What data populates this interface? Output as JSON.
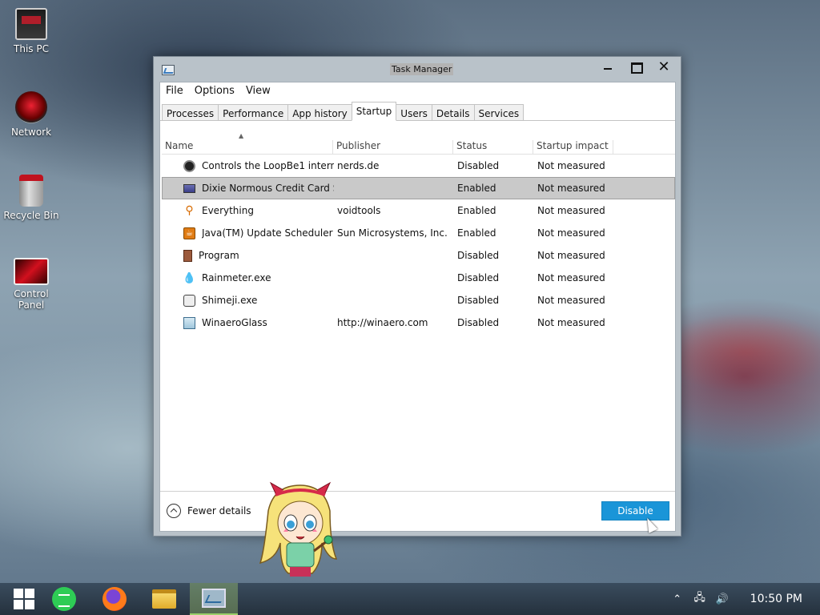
{
  "desktop": {
    "icons": [
      {
        "label": "This PC",
        "icon": "computer-icon"
      },
      {
        "label": "Network",
        "icon": "network-icon"
      },
      {
        "label": "Recycle Bin",
        "icon": "recycle-bin-icon"
      },
      {
        "label": "Control Panel",
        "icon": "control-panel-icon"
      }
    ]
  },
  "window": {
    "title": "Task Manager",
    "menu": [
      "File",
      "Options",
      "View"
    ],
    "tabs": [
      "Processes",
      "Performance",
      "App history",
      "Startup",
      "Users",
      "Details",
      "Services"
    ],
    "active_tab": "Startup",
    "columns": [
      "Name",
      "Publisher",
      "Status",
      "Startup impact"
    ],
    "rows": [
      {
        "name": "Controls the LoopBe1 intern...",
        "publisher": "nerds.de",
        "status": "Disabled",
        "impact": "Not measured",
        "icon": "loopbe-icon"
      },
      {
        "name": "Dixie Normous Credit Card S...",
        "publisher": "",
        "status": "Enabled",
        "impact": "Not measured",
        "icon": "credit-card-icon"
      },
      {
        "name": "Everything",
        "publisher": "voidtools",
        "status": "Enabled",
        "impact": "Not measured",
        "icon": "magnifier-icon"
      },
      {
        "name": "Java(TM) Update Scheduler",
        "publisher": "Sun Microsystems, Inc.",
        "status": "Enabled",
        "impact": "Not measured",
        "icon": "java-icon"
      },
      {
        "name": "Program",
        "publisher": "",
        "status": "Disabled",
        "impact": "Not measured",
        "icon": "program-icon"
      },
      {
        "name": "Rainmeter.exe",
        "publisher": "",
        "status": "Disabled",
        "impact": "Not measured",
        "icon": "raindrop-icon"
      },
      {
        "name": "Shimeji.exe",
        "publisher": "",
        "status": "Disabled",
        "impact": "Not measured",
        "icon": "shimeji-icon"
      },
      {
        "name": "WinaeroGlass",
        "publisher": "http://winaero.com",
        "status": "Disabled",
        "impact": "Not measured",
        "icon": "winaero-icon"
      }
    ],
    "selected_row": 1,
    "fewer_details": "Fewer details",
    "disable_button": "Disable"
  },
  "taskbar": {
    "items": [
      "start-icon",
      "notes-icon",
      "firefox-icon",
      "file-explorer-icon",
      "task-manager-icon"
    ],
    "active_item": "task-manager-icon",
    "clock": "10:50 PM"
  },
  "colors": {
    "accent": "#1a95d8",
    "selection": "#c9c9c9"
  }
}
